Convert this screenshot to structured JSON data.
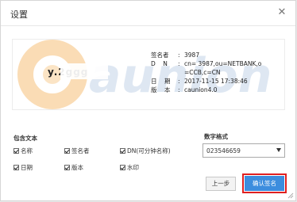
{
  "dialog": {
    "title": "设置",
    "close_glyph": "✕"
  },
  "preview": {
    "signer_name": "y.2ggg",
    "watermark_text": "Caunion",
    "info": [
      {
        "key": "签名者",
        "value": "3987"
      },
      {
        "key": "D    N",
        "value": "cn=      3987,ou=NETBANK,o"
      },
      {
        "key": "",
        "value": "=CCB,c=CN"
      },
      {
        "key": "日    期",
        "value": "2017-11-15 17:38:46"
      },
      {
        "key": "版    本",
        "value": "caunion4.0"
      }
    ],
    "colon": ":"
  },
  "content_section": {
    "label": "包含文本",
    "options": [
      {
        "label": "名称",
        "checked": true
      },
      {
        "label": "签名者",
        "checked": true
      },
      {
        "label": "DN(可分钟名称)",
        "checked": true
      },
      {
        "label": "日期",
        "checked": true
      },
      {
        "label": "版本",
        "checked": true
      },
      {
        "label": "水印",
        "checked": true
      }
    ]
  },
  "digit_format": {
    "label": "数字格式",
    "selected": "023546659"
  },
  "buttons": {
    "prev": "上一步",
    "confirm": "确认签名"
  },
  "colors": {
    "accent": "#3c8dde",
    "highlight": "#e02020",
    "watermark_orange": "#f3b25a",
    "watermark_blue": "#6d94c9"
  }
}
